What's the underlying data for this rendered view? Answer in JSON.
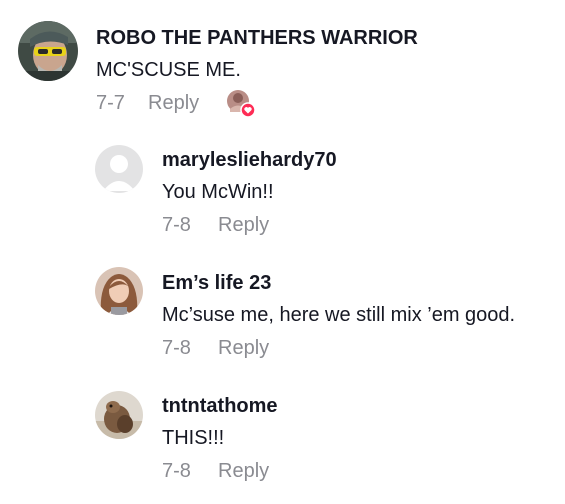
{
  "comments": [
    {
      "username": "ROBO THE PANTHERS WARRIOR",
      "text": "MC'SCUSE ME.",
      "date": "7-7",
      "reply_label": "Reply"
    },
    {
      "username": "marylesliehardy70",
      "text": "You McWin!!",
      "date": "7-8",
      "reply_label": "Reply"
    },
    {
      "username": "Em’s life 23",
      "text": "Mc’suse me, here we still mix ’em good.",
      "date": "7-8",
      "reply_label": "Reply"
    },
    {
      "username": "tntntathome",
      "text": "THIS!!!",
      "date": "7-8",
      "reply_label": "Reply"
    }
  ],
  "colors": {
    "text": "#161823",
    "secondary": "#8a8b91",
    "heart": "#fe2c55"
  }
}
